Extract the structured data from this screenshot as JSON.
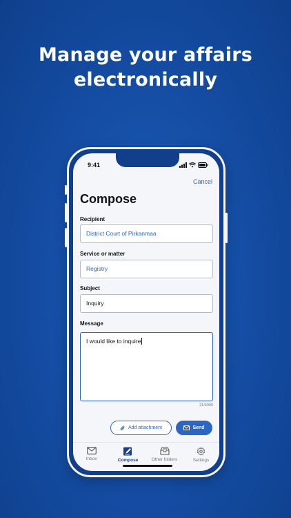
{
  "headline": {
    "line1": "Manage your affairs",
    "line2": "electronically"
  },
  "status": {
    "time": "9:41"
  },
  "header": {
    "cancel_label": "Cancel",
    "title": "Compose"
  },
  "form": {
    "recipient_label": "Recipient",
    "recipient_value": "District Court of Pirkanmaa",
    "service_label": "Service or matter",
    "service_value": "Registry",
    "subject_label": "Subject",
    "subject_value": "Inquiry",
    "message_label": "Message",
    "message_value": "I would like to inquire",
    "counter": "21/4000"
  },
  "actions": {
    "attach_label": "Add attachment",
    "send_label": "Send"
  },
  "tabs": [
    {
      "label": "Inbox",
      "icon": "envelope-icon",
      "active": false
    },
    {
      "label": "Compose",
      "icon": "compose-icon",
      "active": true
    },
    {
      "label": "Other folders",
      "icon": "folder-tray-icon",
      "active": false
    },
    {
      "label": "Settings",
      "icon": "gear-icon",
      "active": false
    }
  ],
  "colors": {
    "accent": "#2b66c4",
    "background": "#1650a8",
    "active_tab": "#1b3f8a"
  }
}
